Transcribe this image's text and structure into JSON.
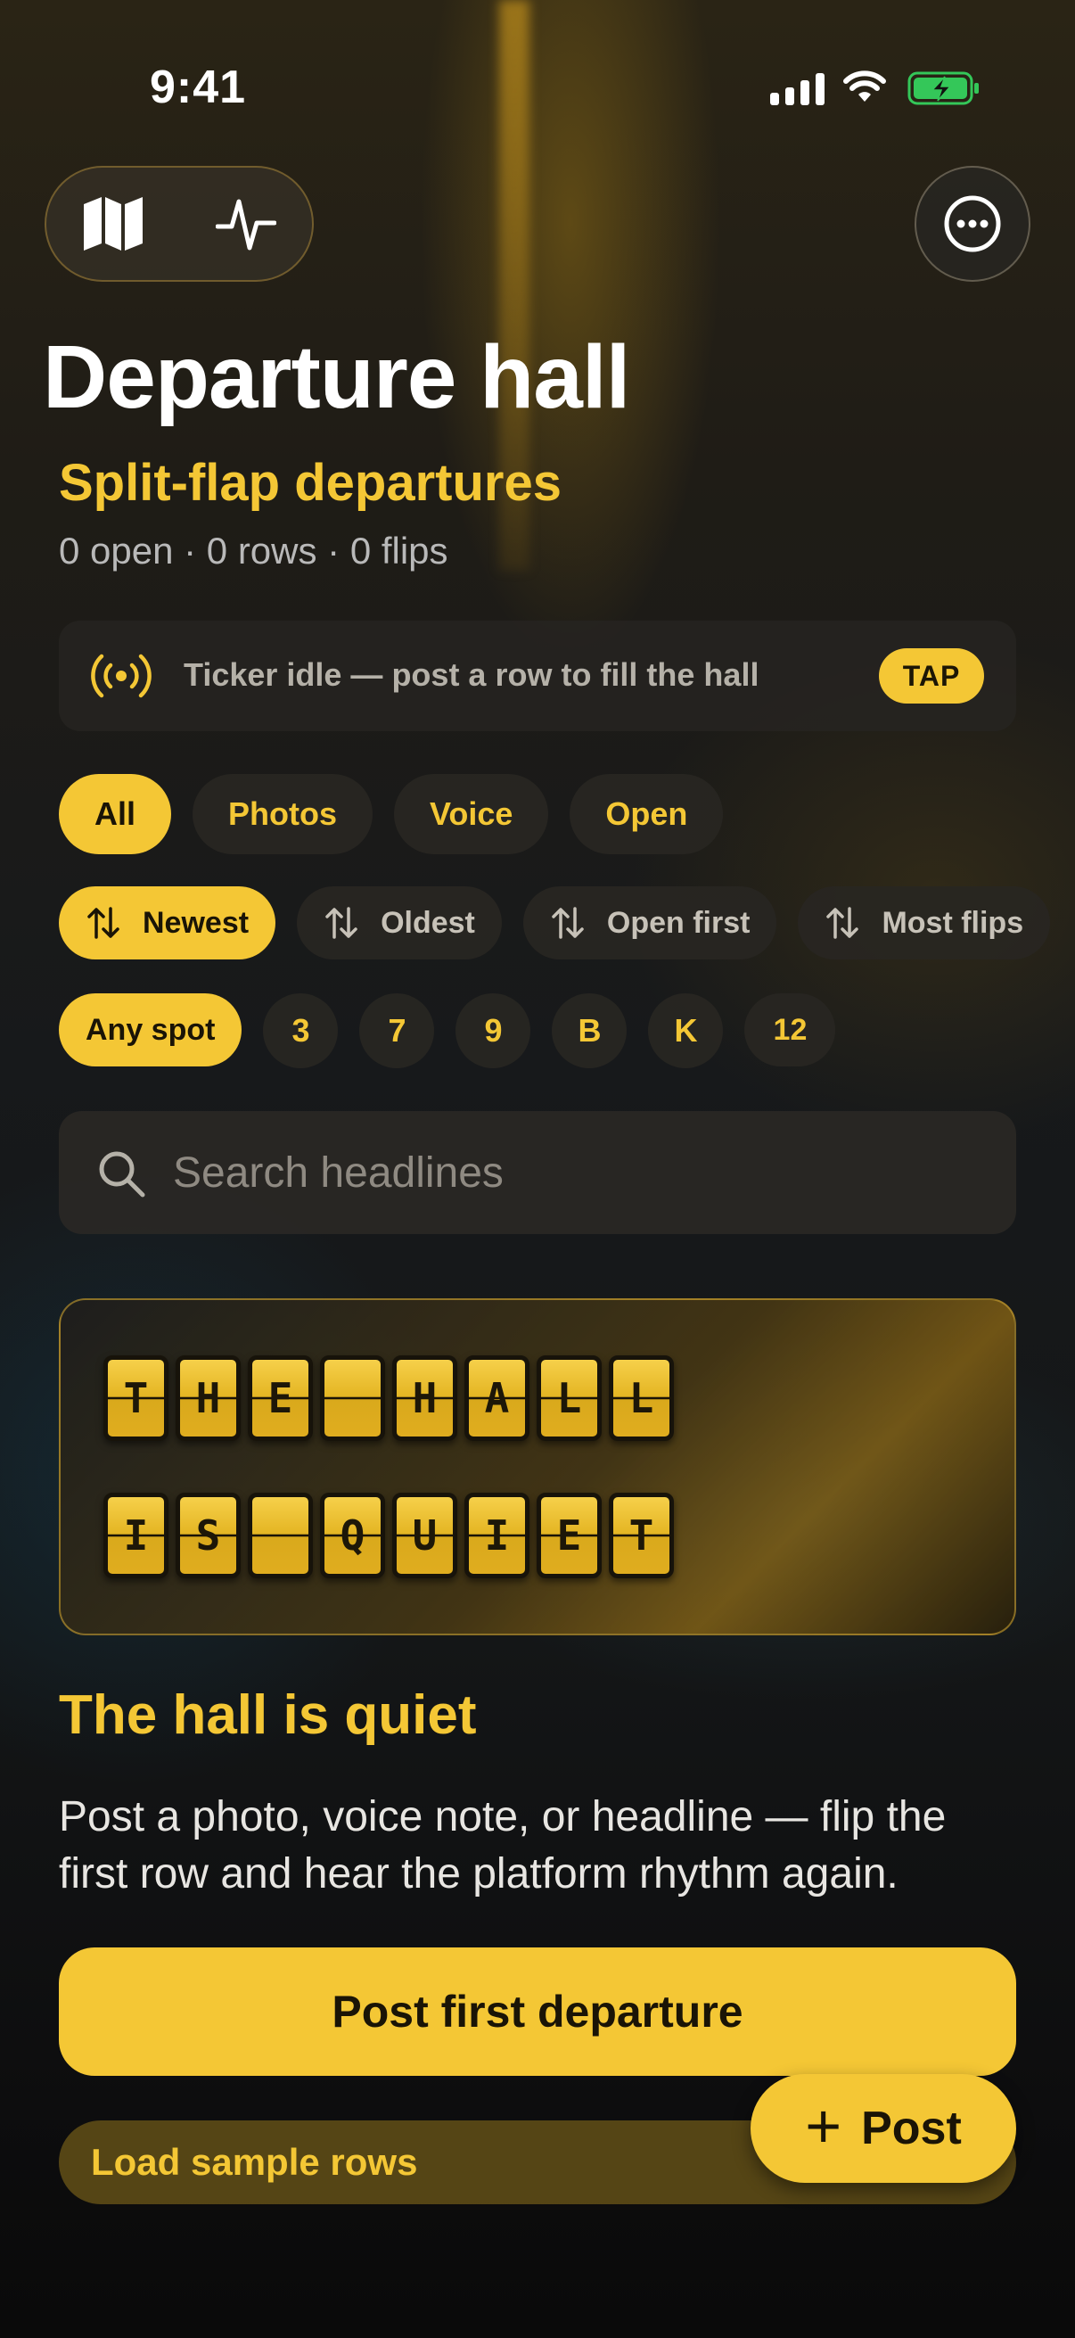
{
  "status_bar": {
    "time": "9:41"
  },
  "header": {
    "title": "Departure hall",
    "subtitle": "Split-flap departures",
    "stats": "0 open · 0 rows · 0 flips"
  },
  "ticker": {
    "text": "Ticker idle — post a row to fill the hall",
    "action": "TAP"
  },
  "filters": {
    "type": [
      "All",
      "Photos",
      "Voice",
      "Open"
    ],
    "sort": [
      "Newest",
      "Oldest",
      "Open first",
      "Most flips"
    ],
    "spot": [
      "Any spot",
      "3",
      "7",
      "9",
      "B",
      "K",
      "12"
    ]
  },
  "search": {
    "placeholder": "Search headlines"
  },
  "board": {
    "row1": [
      "T",
      "H",
      "E",
      "",
      "H",
      "A",
      "L",
      "L"
    ],
    "row2": [
      "I",
      "S",
      "",
      "Q",
      "U",
      "I",
      "E",
      "T"
    ]
  },
  "empty_state": {
    "title": "The hall is quiet",
    "description": "Post a photo, voice note, or headline — flip the first row and hear the platform rhythm again.",
    "primary_button": "Post first departure",
    "secondary_button": "Load sample rows"
  },
  "fab": {
    "label": "Post"
  },
  "colors": {
    "accent": "#f4c735",
    "background": "#0f0f10"
  }
}
